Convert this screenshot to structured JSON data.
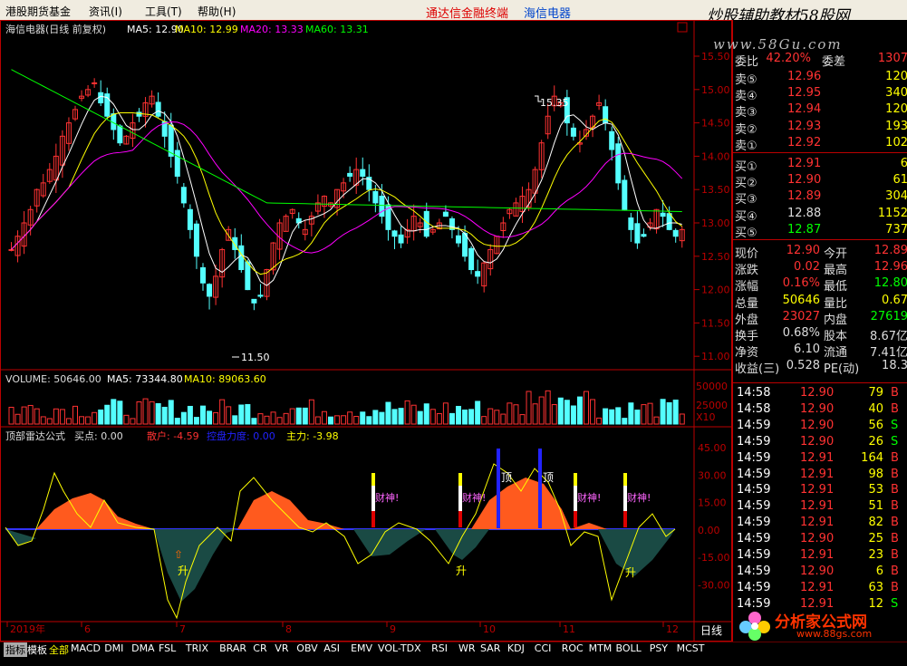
{
  "menu": {
    "items": [
      "港股期货基金",
      "资讯(I)",
      "工具(T)",
      "帮助(H)"
    ],
    "brand": "通达信金融终端",
    "stock_name": "海信电器",
    "watermark_top": "炒股辅助教材58股网",
    "watermark_sub": "www.58Gu.com"
  },
  "chart_header": {
    "title": "海信电器(日线 前复权)",
    "ma5": "MA5: 12.90",
    "ma10": "MA10: 12.99",
    "ma20": "MA20: 13.33",
    "ma60": "MA60: 13.31",
    "high_label": "15.35",
    "low_label": "11.50"
  },
  "price_axis": [
    "15.50",
    "15.00",
    "14.50",
    "14.00",
    "13.50",
    "13.00",
    "12.50",
    "12.00",
    "11.50",
    "11.00"
  ],
  "volume_header": {
    "volume": "VOLUME: 50646.00",
    "ma5": "MA5: 73344.80",
    "ma10": "MA10: 89063.60"
  },
  "volume_axis": [
    "50000",
    "25000",
    "X10"
  ],
  "indicator_header": {
    "name": "顶部雷达公式",
    "buy": "买点: 0.00",
    "sanhu": "散户: -4.59",
    "zhuli": "主力: -3.98",
    "hidden": "控盘力度: 0.00"
  },
  "indicator_axis": [
    "45.00",
    "30.00",
    "15.00",
    "0.00",
    "-15.00",
    "-30.00"
  ],
  "indicator_marks": {
    "caishen": "财神!",
    "ding": "顶",
    "sheng": "升"
  },
  "date_axis": [
    "2019年",
    "6",
    "7",
    "8",
    "9",
    "10",
    "11",
    "12"
  ],
  "period_label": "日线",
  "quote": {
    "weibi_label": "委比",
    "weibi": "42.20%",
    "weicha_label": "委差",
    "weicha": "1307",
    "asks": [
      {
        "label": "卖⑤",
        "price": "12.96",
        "vol": "120"
      },
      {
        "label": "卖④",
        "price": "12.95",
        "vol": "340"
      },
      {
        "label": "卖③",
        "price": "12.94",
        "vol": "120"
      },
      {
        "label": "卖②",
        "price": "12.93",
        "vol": "193"
      },
      {
        "label": "卖①",
        "price": "12.92",
        "vol": "102"
      }
    ],
    "bids": [
      {
        "label": "买①",
        "price": "12.91",
        "vol": "6"
      },
      {
        "label": "买②",
        "price": "12.90",
        "vol": "61"
      },
      {
        "label": "买③",
        "price": "12.89",
        "vol": "304"
      },
      {
        "label": "买④",
        "price": "12.88",
        "vol": "1152"
      },
      {
        "label": "买⑤",
        "price": "12.87",
        "vol": "737"
      }
    ],
    "stats": [
      {
        "l1": "现价",
        "v1": "12.90",
        "l2": "今开",
        "v2": "12.89"
      },
      {
        "l1": "涨跌",
        "v1": "0.02",
        "l2": "最高",
        "v2": "12.96"
      },
      {
        "l1": "涨幅",
        "v1": "0.16%",
        "l2": "最低",
        "v2": "12.80"
      },
      {
        "l1": "总量",
        "v1": "50646",
        "l2": "量比",
        "v2": "0.67"
      },
      {
        "l1": "外盘",
        "v1": "23027",
        "l2": "内盘",
        "v2": "27619"
      },
      {
        "l1": "换手",
        "v1": "0.68%",
        "l2": "股本",
        "v2": "8.67亿"
      },
      {
        "l1": "净资",
        "v1": "6.10",
        "l2": "流通",
        "v2": "7.41亿"
      },
      {
        "l1": "收益(三)",
        "v1": "0.528",
        "l2": "PE(动)",
        "v2": "18.3"
      }
    ],
    "ticks": [
      {
        "time": "14:58",
        "price": "12.90",
        "vol": "79",
        "dir": "B"
      },
      {
        "time": "14:58",
        "price": "12.90",
        "vol": "40",
        "dir": "B"
      },
      {
        "time": "14:59",
        "price": "12.90",
        "vol": "56",
        "dir": "S"
      },
      {
        "time": "14:59",
        "price": "12.90",
        "vol": "26",
        "dir": "S"
      },
      {
        "time": "14:59",
        "price": "12.91",
        "vol": "164",
        "dir": "B"
      },
      {
        "time": "14:59",
        "price": "12.91",
        "vol": "98",
        "dir": "B"
      },
      {
        "time": "14:59",
        "price": "12.91",
        "vol": "53",
        "dir": "B"
      },
      {
        "time": "14:59",
        "price": "12.91",
        "vol": "51",
        "dir": "B"
      },
      {
        "time": "14:59",
        "price": "12.91",
        "vol": "82",
        "dir": "B"
      },
      {
        "time": "14:59",
        "price": "12.90",
        "vol": "25",
        "dir": "B"
      },
      {
        "time": "14:59",
        "price": "12.91",
        "vol": "23",
        "dir": "B"
      },
      {
        "time": "14:59",
        "price": "12.90",
        "vol": "6",
        "dir": "B"
      },
      {
        "time": "14:59",
        "price": "12.91",
        "vol": "63",
        "dir": "B"
      },
      {
        "time": "14:59",
        "price": "12.91",
        "vol": "12",
        "dir": "S"
      }
    ],
    "logo_text": "分析家公式网",
    "logo_url": "www.88gs.com"
  },
  "bottom_tabs": [
    "指标",
    "模板",
    "全部",
    "MACD",
    "DMI",
    "DMA",
    "FSL",
    "TRIX",
    "BRAR",
    "CR",
    "VR",
    "OBV",
    "ASI",
    "EMV",
    "VOL-TDX",
    "RSI",
    "WR",
    "SAR",
    "KDJ",
    "CCI",
    "ROC",
    "MTM",
    "BOLL",
    "PSY",
    "MCST"
  ],
  "colors": {
    "up": "#ff3232",
    "down": "#54ffff",
    "ma5": "#ffffff",
    "ma10": "#ffff00",
    "ma20": "#ff00ff",
    "ma60": "#00ff00",
    "sanhu_fill": "#ff5a1e",
    "zhuli_fill": "#1a4a44"
  }
}
